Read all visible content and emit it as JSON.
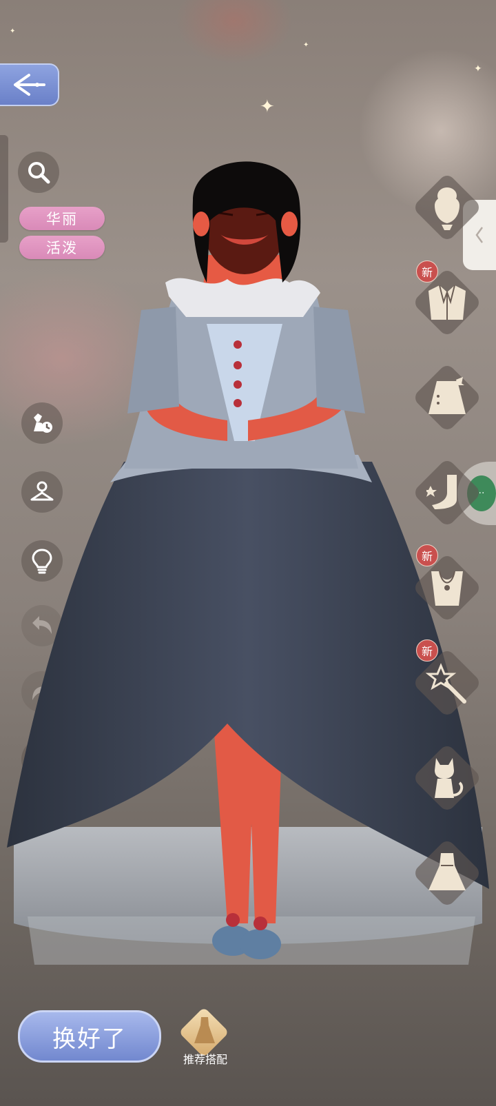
{
  "tags": [
    "华丽",
    "活泼"
  ],
  "categories": [
    {
      "icon": "hair-icon",
      "new": false
    },
    {
      "icon": "jacket-icon",
      "new": true
    },
    {
      "icon": "skirt-icon",
      "new": false
    },
    {
      "icon": "shoe-icon",
      "new": false
    },
    {
      "icon": "necklace-icon",
      "new": true
    },
    {
      "icon": "wand-icon",
      "new": true
    },
    {
      "icon": "cat-icon",
      "new": false
    },
    {
      "icon": "dress-icon",
      "new": false
    }
  ],
  "new_badge_label": "新",
  "footer": {
    "confirm_label": "换好了",
    "recommend_label": "推荐搭配"
  },
  "colors": {
    "tag_pink": "#e7a0c8",
    "confirm_blue": "#8ea2de",
    "badge_red": "#c9504e",
    "gown_dark": "#3a4150",
    "bodice_silver": "#9ea8b8",
    "skin": "#e65a44"
  }
}
